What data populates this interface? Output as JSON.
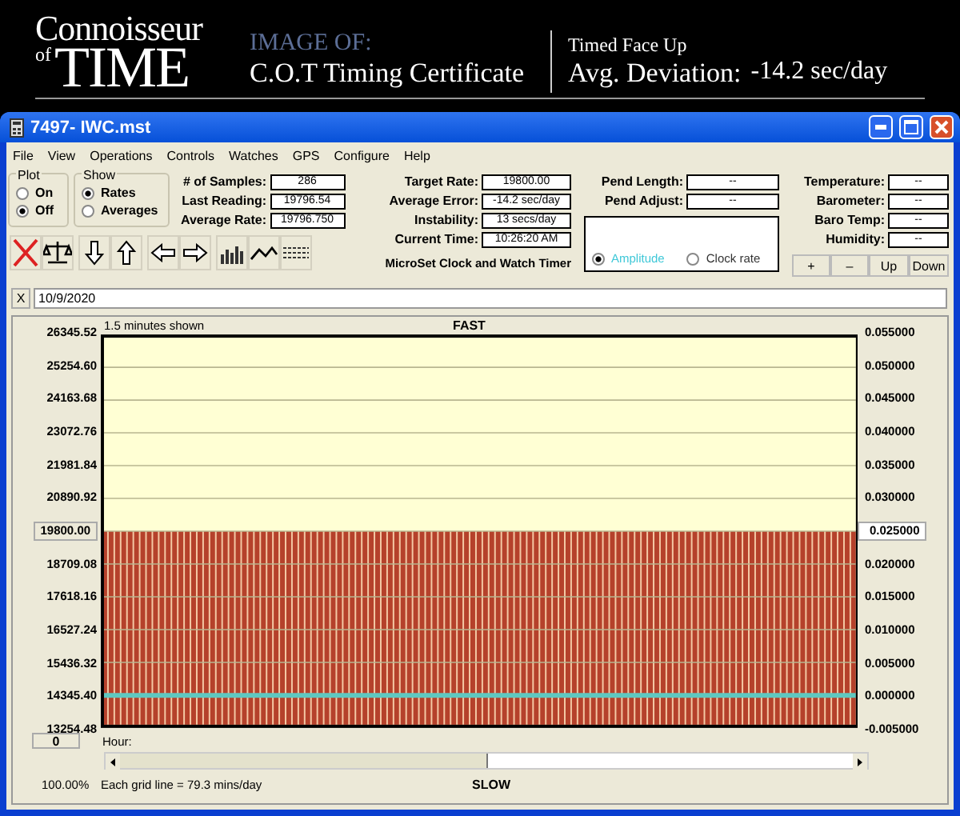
{
  "banner": {
    "logo_top": "Connoisseur",
    "logo_of": "of",
    "logo_main": "TIME",
    "kicker": "IMAGE OF:",
    "title": "C.O.T Timing Certificate",
    "position": "Timed Face Up",
    "deviation_label": "Avg. Deviation:",
    "deviation_value": "-14.2 sec/day"
  },
  "window": {
    "title": "7497- IWC.mst"
  },
  "menu": [
    "File",
    "View",
    "Operations",
    "Controls",
    "Watches",
    "GPS",
    "Configure",
    "Help"
  ],
  "plot_group": {
    "title": "Plot",
    "options": [
      {
        "label": "On",
        "selected": false
      },
      {
        "label": "Off",
        "selected": true
      }
    ]
  },
  "show_group": {
    "title": "Show",
    "options": [
      {
        "label": "Rates",
        "selected": true
      },
      {
        "label": "Averages",
        "selected": false
      }
    ]
  },
  "stats": [
    {
      "label": "# of Samples:",
      "value": "286"
    },
    {
      "label": "Last Reading:",
      "value": "19796.54"
    },
    {
      "label": "Average Rate:",
      "value": "19796.750"
    }
  ],
  "rates": [
    {
      "label": "Target Rate:",
      "value": "19800.00"
    },
    {
      "label": "Average Error:",
      "value": "-14.2 sec/day"
    },
    {
      "label": "Instability:",
      "value": "13 secs/day"
    },
    {
      "label": "Current Time:",
      "value": "10:26:20 AM"
    }
  ],
  "microset_label": "MicroSet Clock and Watch Timer",
  "pend": [
    {
      "label": "Pend Length:",
      "value": "--"
    },
    {
      "label": "Pend Adjust:",
      "value": "--"
    }
  ],
  "mode": [
    {
      "label": "Amplitude",
      "selected": true
    },
    {
      "label": "Clock rate",
      "selected": false
    }
  ],
  "sensors": [
    {
      "label": "Temperature:",
      "value": "--"
    },
    {
      "label": "Barometer:",
      "value": "--"
    },
    {
      "label": "Baro Temp:",
      "value": "--"
    },
    {
      "label": "Humidity:",
      "value": "--"
    }
  ],
  "adjust_buttons": [
    "+",
    "–",
    "Up",
    "Down"
  ],
  "date_row": {
    "close": "X",
    "value": "10/9/2020"
  },
  "graph": {
    "span": "1.5 minutes shown",
    "top_label": "FAST",
    "bottom_label": "SLOW",
    "hour_value": "0",
    "hour_label": "Hour:",
    "zoom": "100.00%",
    "grid_note": "Each grid line = 79.3 mins/day",
    "left_ticks": [
      {
        "kind": "label",
        "text": "26345.52"
      },
      {
        "kind": "label",
        "text": "25254.60"
      },
      {
        "kind": "label",
        "text": "24163.68"
      },
      {
        "kind": "label",
        "text": "23072.76"
      },
      {
        "kind": "label",
        "text": "21981.84"
      },
      {
        "kind": "label",
        "text": "20890.92"
      },
      {
        "kind": "marker",
        "text": "19800.00"
      },
      {
        "kind": "label",
        "text": "18709.08"
      },
      {
        "kind": "label",
        "text": "17618.16"
      },
      {
        "kind": "label",
        "text": "16527.24"
      },
      {
        "kind": "label",
        "text": "15436.32"
      },
      {
        "kind": "label",
        "text": "14345.40"
      },
      {
        "kind": "label",
        "text": "13254.48"
      }
    ],
    "right_ticks": [
      {
        "kind": "label",
        "text": "0.055000"
      },
      {
        "kind": "label",
        "text": "0.050000"
      },
      {
        "kind": "label",
        "text": "0.045000"
      },
      {
        "kind": "label",
        "text": "0.040000"
      },
      {
        "kind": "label",
        "text": "0.035000"
      },
      {
        "kind": "label",
        "text": "0.030000"
      },
      {
        "kind": "marker",
        "text": "0.025000"
      },
      {
        "kind": "label",
        "text": "0.020000"
      },
      {
        "kind": "label",
        "text": "0.015000"
      },
      {
        "kind": "label",
        "text": "0.010000"
      },
      {
        "kind": "label",
        "text": "0.005000"
      },
      {
        "kind": "label",
        "text": "0.000000"
      },
      {
        "kind": "label",
        "text": "-0.005000"
      }
    ]
  }
}
